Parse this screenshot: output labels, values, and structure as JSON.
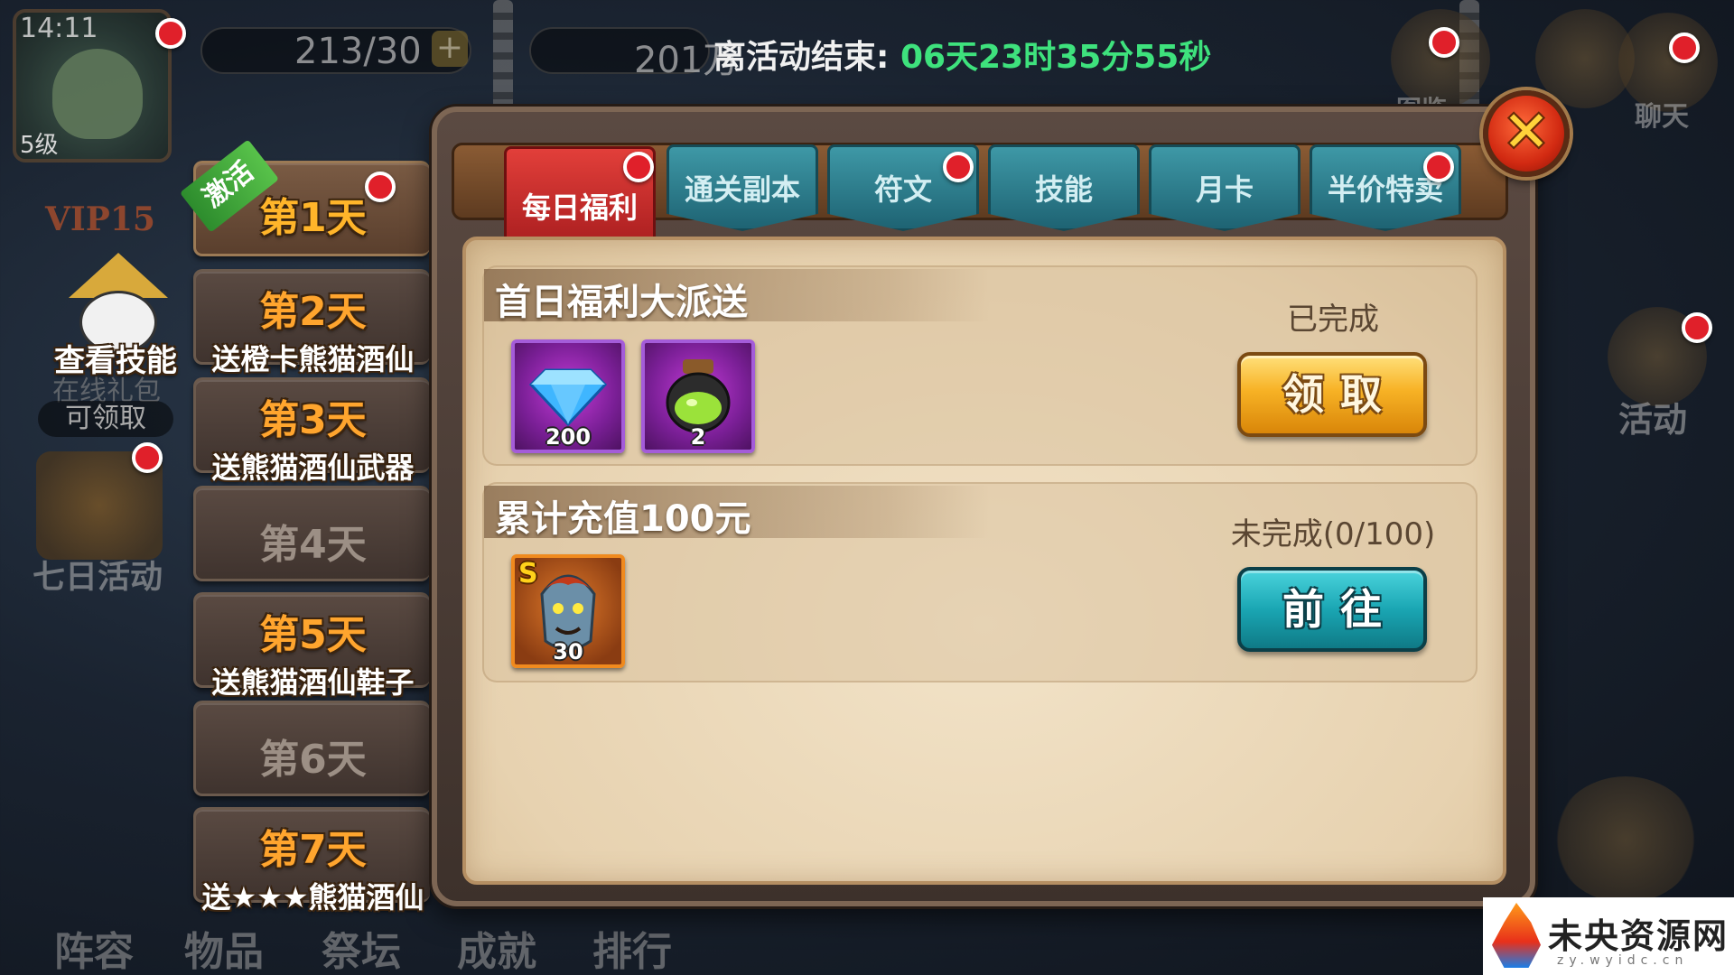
{
  "hud": {
    "time": "14:11",
    "level": "5级",
    "vip": "VIP15",
    "stamina": "213/30",
    "gold": "201万",
    "event_timer_label": "离活动结束:",
    "event_timer_value": "06天23时35分55秒"
  },
  "side_right": {
    "atlas": "图鉴",
    "chat": "聊天",
    "activity": "活动"
  },
  "side_left": {
    "view_skill": "查看技能",
    "online_gift": "在线礼包",
    "claimable": "可领取",
    "seven_day": "七日活动"
  },
  "bottom_nav": [
    "阵容",
    "物品",
    "祭坛",
    "成就",
    "排行"
  ],
  "days": [
    {
      "title": "第1天",
      "sub": ""
    },
    {
      "title": "第2天",
      "sub": "送橙卡熊猫酒仙"
    },
    {
      "title": "第3天",
      "sub": "送熊猫酒仙武器"
    },
    {
      "title": "第4天",
      "sub": ""
    },
    {
      "title": "第5天",
      "sub": "送熊猫酒仙鞋子"
    },
    {
      "title": "第6天",
      "sub": ""
    },
    {
      "title": "第7天",
      "sub": "送★★★熊猫酒仙"
    }
  ],
  "activate_ribbon": "激活",
  "tabs": [
    "每日福利",
    "通关副本",
    "符文",
    "技能",
    "月卡",
    "半价特卖"
  ],
  "tasks": [
    {
      "title": "首日福利大派送",
      "status": "已完成",
      "button": "领取",
      "rewards": [
        {
          "icon": "diamond-icon",
          "qty": "200"
        },
        {
          "icon": "potion-jar-icon",
          "qty": "2"
        }
      ]
    },
    {
      "title": "累计充值100元",
      "status": "未完成(0/100)",
      "button": "前往",
      "rewards": [
        {
          "icon": "hero-card-icon",
          "qty": "30",
          "grade": "S"
        }
      ]
    }
  ],
  "close_symbol": "✕",
  "watermark": {
    "name": "未央资源网",
    "sub": "zy.wyidc.cn"
  },
  "colors": {
    "timer_green": "#3ee27d",
    "tab_active": "#e23f3a",
    "tab_idle": "#3e98a6",
    "button_gold": "#f7b225",
    "button_teal": "#1aa6b3"
  }
}
